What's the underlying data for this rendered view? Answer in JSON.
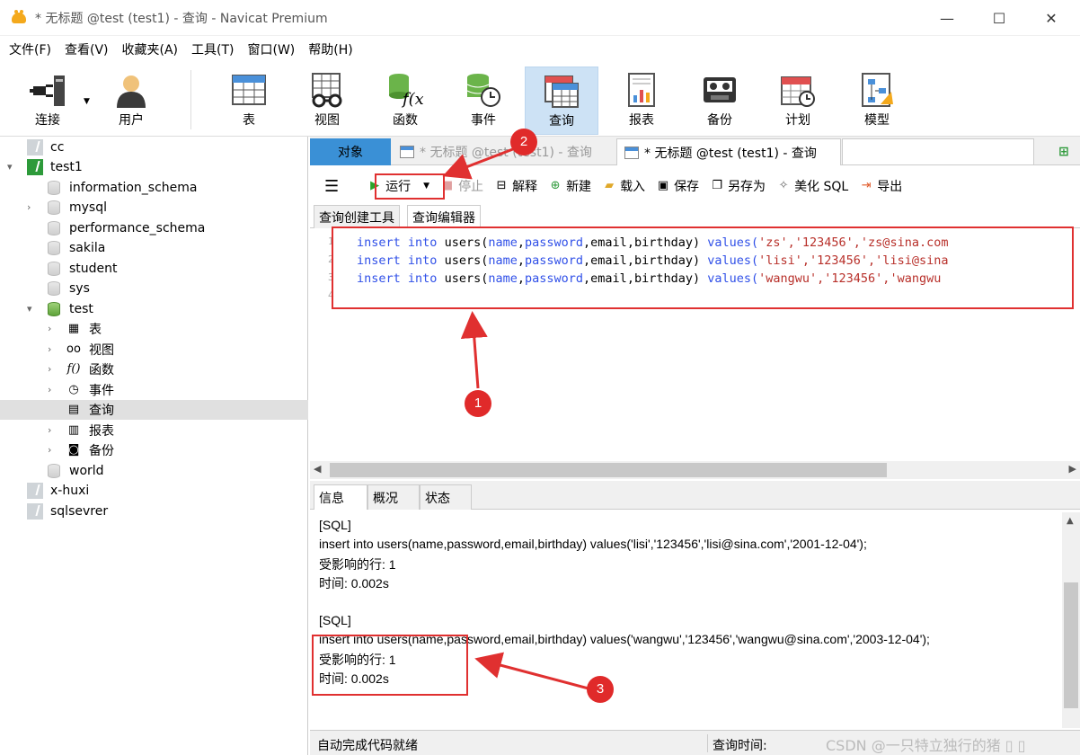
{
  "window": {
    "title": "* 无标题 @test (test1) - 查询 - Navicat Premium",
    "controls": {
      "minimize": "—",
      "maximize": "☐",
      "close": "✕"
    }
  },
  "menu": [
    "文件(F)",
    "查看(V)",
    "收藏夹(A)",
    "工具(T)",
    "窗口(W)",
    "帮助(H)"
  ],
  "toolbar": {
    "connect": "连接",
    "user": "用户",
    "table": "表",
    "view": "视图",
    "function": "函数",
    "event": "事件",
    "query": "查询",
    "report": "报表",
    "backup": "备份",
    "schedule": "计划",
    "model": "模型"
  },
  "tree": {
    "cc": "cc",
    "test1": "test1",
    "information_schema": "information_schema",
    "mysql": "mysql",
    "performance_schema": "performance_schema",
    "sakila": "sakila",
    "student": "student",
    "sys": "sys",
    "test": "test",
    "tables": "表",
    "views": "视图",
    "functions": "函数",
    "events": "事件",
    "queries": "查询",
    "reports": "报表",
    "backups": "备份",
    "world": "world",
    "x_huxi": "x-huxi",
    "sqlsevrer": "sqlsevrer"
  },
  "tabs": {
    "object": "对象",
    "query1": "* 无标题 @test (test1) - 查询",
    "query2": "* 无标题 @test (test1) - 查询"
  },
  "query_toolbar": {
    "run": "运行",
    "stop": "停止",
    "explain": "解释",
    "new": "新建",
    "load": "载入",
    "save": "保存",
    "save_as": "另存为",
    "beautify": "美化 SQL",
    "export": "导出"
  },
  "sub_tabs": {
    "builder": "查询创建工具",
    "editor": "查询编辑器"
  },
  "editor": {
    "line_numbers": [
      "1",
      "2",
      "3",
      "4"
    ],
    "lines": [
      {
        "kw1": "insert",
        "kw2": "into",
        "table": "users(",
        "cols": "name",
        "c1": ",",
        "c2": "password",
        "rest": ",email,birthday)",
        "kw3": "values(",
        "vals": "'zs','123456','zs@sina.com"
      },
      {
        "kw1": "insert",
        "kw2": "into",
        "table": "users(",
        "cols": "name",
        "c1": ",",
        "c2": "password",
        "rest": ",email,birthday)",
        "kw3": "values(",
        "vals": "'lisi','123456','lisi@sina"
      },
      {
        "kw1": "insert",
        "kw2": "into",
        "table": "users(",
        "cols": "name",
        "c1": ",",
        "c2": "password",
        "rest": ",email,birthday)",
        "kw3": "values(",
        "vals": "'wangwu','123456','wangwu"
      }
    ]
  },
  "result_tabs": {
    "info": "信息",
    "profile": "概况",
    "status": "状态"
  },
  "messages": {
    "sql1": "[SQL]",
    "stmt1": "insert into users(name,password,email,birthday) values('lisi','123456','lisi@sina.com','2001-12-04');",
    "rows1": "受影响的行: 1",
    "time1": "时间: 0.002s",
    "sql2": "[SQL]",
    "stmt2": "insert into users(name,password,email,birthday) values('wangwu','123456','wangwu@sina.com','2003-12-04');",
    "rows2": "受影响的行: 1",
    "time2": "时间: 0.002s"
  },
  "statusbar": {
    "left": "自动完成代码就绪",
    "query_time": "查询时间:",
    "watermark": "CSDN @一只特立独行的猪 ▯ ▯"
  },
  "annotations": {
    "b1": "1",
    "b2": "2",
    "b3": "3"
  },
  "colors": {
    "accent": "#3a90d6",
    "annotation": "#e03030"
  }
}
